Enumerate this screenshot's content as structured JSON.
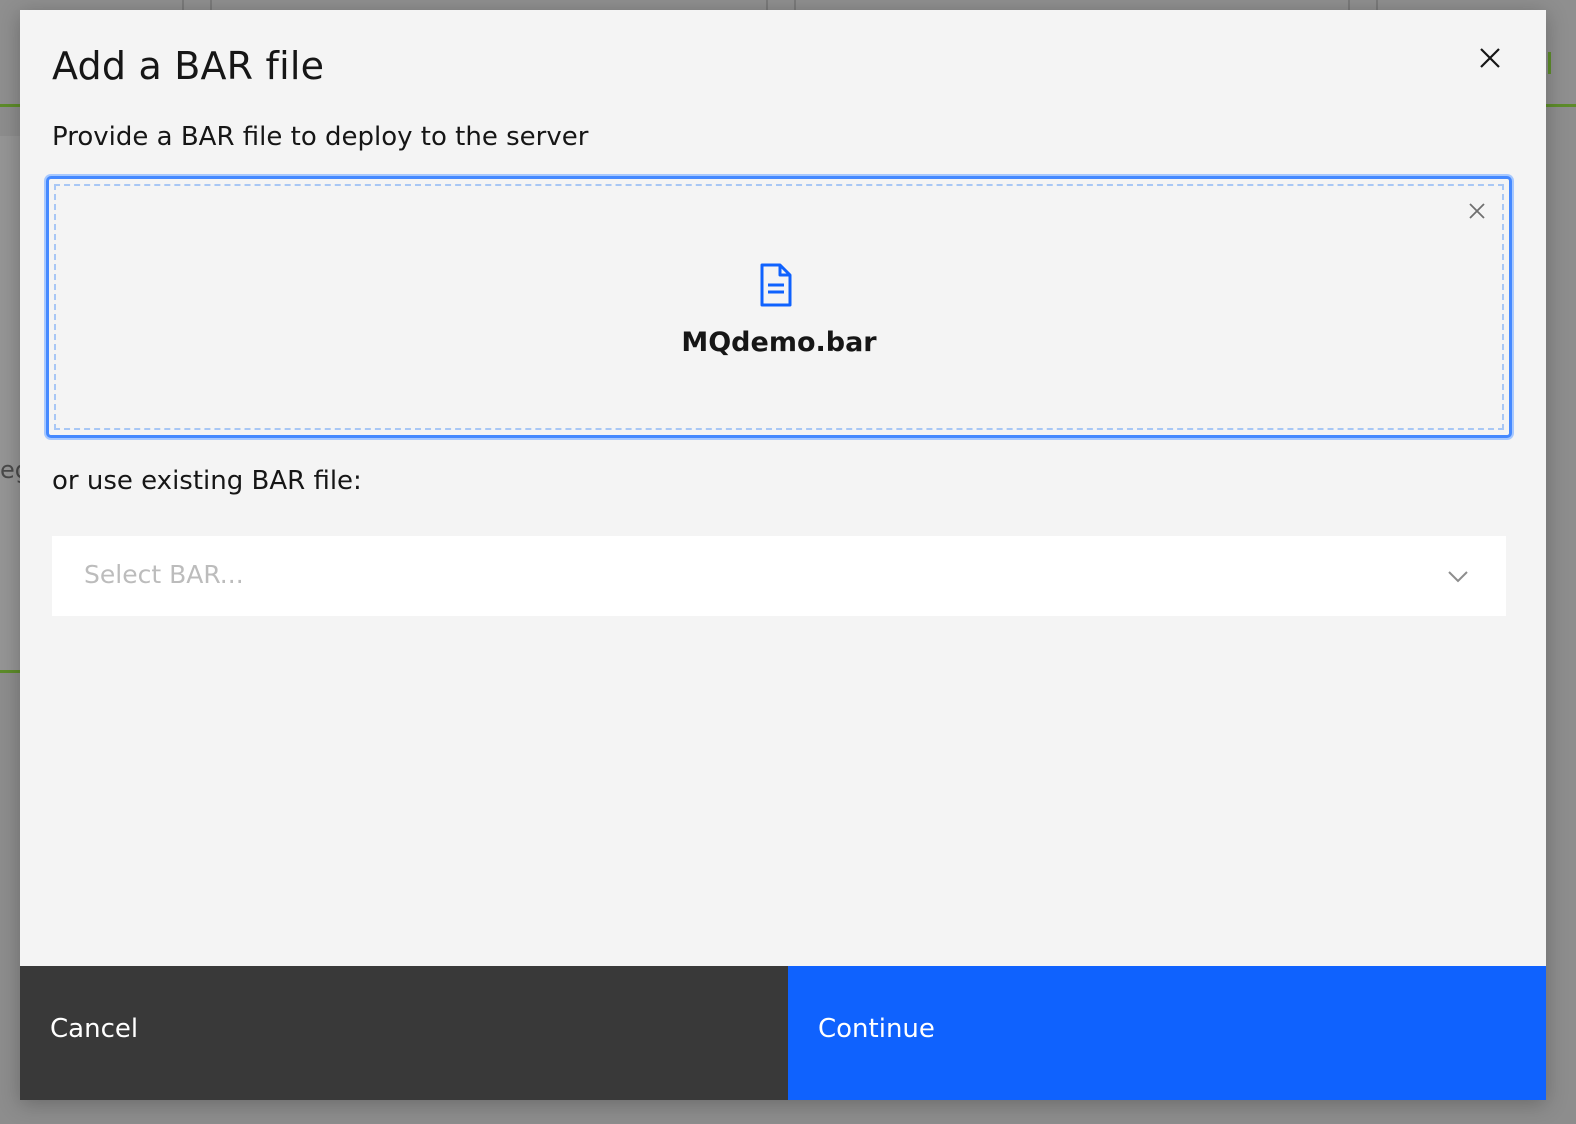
{
  "modal": {
    "title": "Add a BAR file",
    "subtitle": "Provide a BAR file to deploy to the server",
    "close_icon": "close-icon"
  },
  "upload": {
    "file_name": "MQdemo.bar",
    "file_icon": "document-icon",
    "remove_icon": "close-icon",
    "accent_color": "#0f62fe",
    "focus_color": "#4589ff"
  },
  "existing": {
    "label": "or use existing BAR file:",
    "placeholder": "Select BAR...",
    "chevron_icon": "chevron-down-icon"
  },
  "footer": {
    "cancel_label": "Cancel",
    "continue_label": "Continue",
    "cancel_color": "#393939",
    "continue_color": "#0f62fe"
  },
  "background": {
    "partial_text": "eg"
  }
}
